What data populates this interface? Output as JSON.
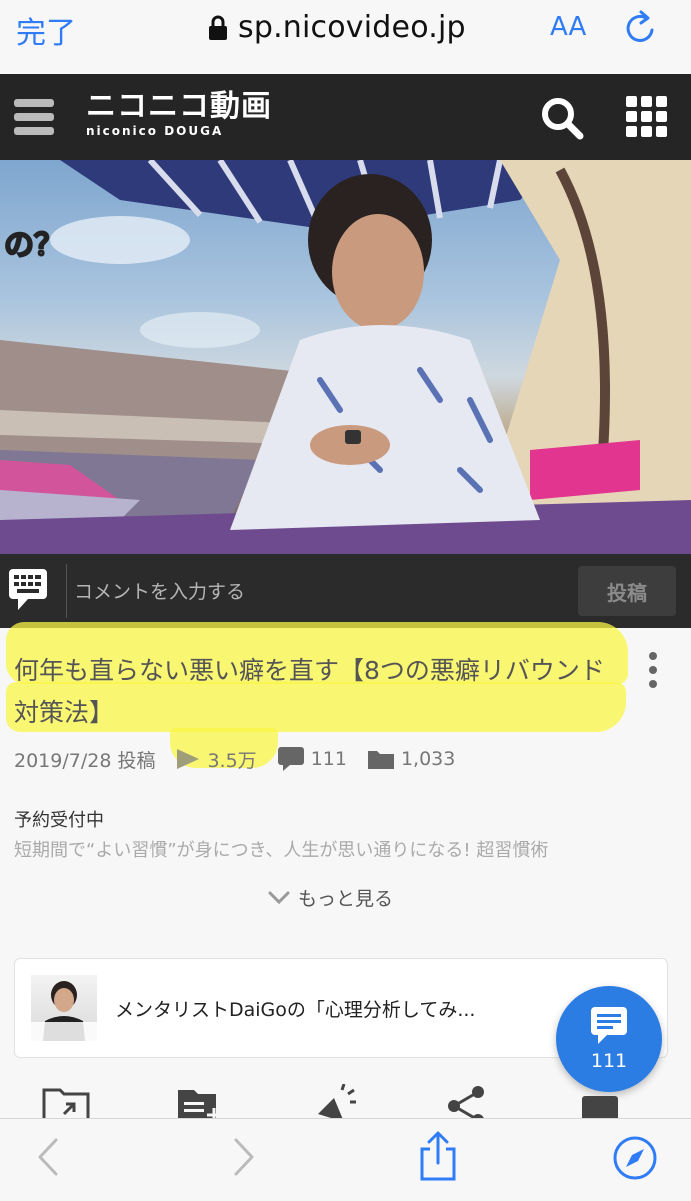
{
  "safari_top": {
    "done_label": "完了",
    "url": "sp.nicovideo.jp",
    "text_size_label": "AA"
  },
  "site": {
    "logo_main": "ニコニコ動画",
    "logo_sub": "niconico DOUGA"
  },
  "video": {
    "overlay_text": "の？"
  },
  "comment_bar": {
    "placeholder": "コメントを入力する",
    "post_label": "投稿"
  },
  "video_info": {
    "title": "何年も直らない悪い癖を直す【8つの悪癖リバウンド対策法】",
    "date": "2019/7/28 投稿",
    "views": "3.5万",
    "comments": "111",
    "mylists": "1,033"
  },
  "description": {
    "label": "予約受付中",
    "text": "短期間で“よい習慣”が身につき、人生が思い通りになる! 超習慣術",
    "more_label": "もっと見る"
  },
  "channel": {
    "name": "メンタリストDaiGoの「心理分析してみ...",
    "thumb_caption": "メンタリストDaiGoの「心理分析してみた!」"
  },
  "fab": {
    "comment_count": "111"
  },
  "colors": {
    "accent": "#2f7cf6",
    "fab": "#2b7de4",
    "highlight": "#faf546",
    "header_bg": "#252525"
  }
}
